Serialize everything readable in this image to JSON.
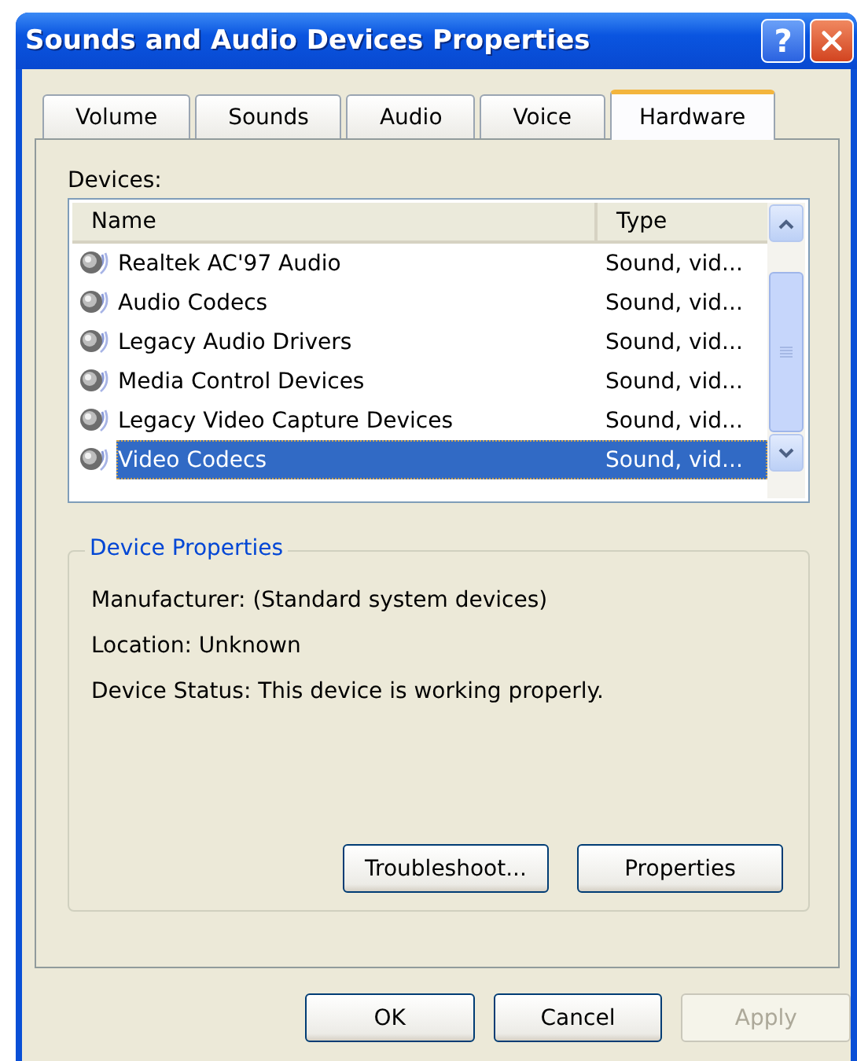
{
  "window": {
    "title": "Sounds and Audio Devices Properties",
    "controls": [
      {
        "kind": "help",
        "label": "?"
      },
      {
        "kind": "close"
      }
    ]
  },
  "tabs": [
    {
      "label": "Volume",
      "selected": false
    },
    {
      "label": "Sounds",
      "selected": false
    },
    {
      "label": "Audio",
      "selected": false
    },
    {
      "label": "Voice",
      "selected": false
    },
    {
      "label": "Hardware",
      "selected": true
    }
  ],
  "devices": {
    "label": "Devices:",
    "columns": [
      "Name",
      "Type"
    ],
    "rows": [
      {
        "name": "Realtek AC'97 Audio",
        "type": "Sound, vid...",
        "selected": false
      },
      {
        "name": "Audio Codecs",
        "type": "Sound, vid...",
        "selected": false
      },
      {
        "name": "Legacy Audio Drivers",
        "type": "Sound, vid...",
        "selected": false
      },
      {
        "name": "Media Control Devices",
        "type": "Sound, vid...",
        "selected": false
      },
      {
        "name": "Legacy Video Capture Devices",
        "type": "Sound, vid...",
        "selected": false
      },
      {
        "name": "Video Codecs",
        "type": "Sound, vid...",
        "selected": true
      }
    ]
  },
  "device_properties": {
    "title": "Device Properties",
    "lines": [
      "Manufacturer: (Standard system devices)",
      "Location: Unknown",
      "Device Status: This device is working properly."
    ],
    "buttons": [
      {
        "label": "Troubleshoot...",
        "disabled": false
      },
      {
        "label": "Properties",
        "disabled": false
      }
    ]
  },
  "buttons": [
    {
      "label": "OK",
      "disabled": false
    },
    {
      "label": "Cancel",
      "disabled": false
    },
    {
      "label": "Apply",
      "disabled": true
    }
  ]
}
